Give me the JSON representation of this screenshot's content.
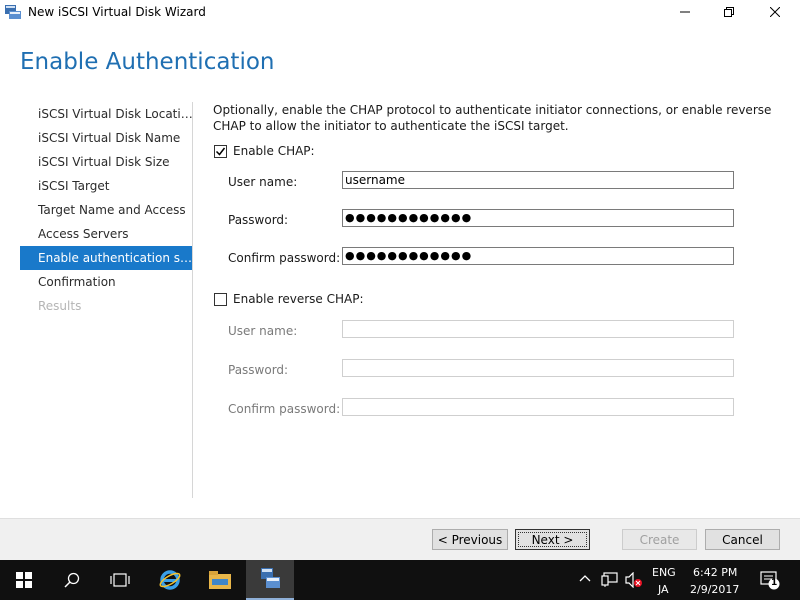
{
  "window": {
    "title": "New iSCSI Virtual Disk Wizard"
  },
  "header": {
    "title": "Enable Authentication"
  },
  "nav": {
    "items": [
      {
        "label": "iSCSI Virtual Disk Location",
        "state": "normal"
      },
      {
        "label": "iSCSI Virtual Disk Name",
        "state": "normal"
      },
      {
        "label": "iSCSI Virtual Disk Size",
        "state": "normal"
      },
      {
        "label": "iSCSI Target",
        "state": "normal"
      },
      {
        "label": "Target Name and Access",
        "state": "normal"
      },
      {
        "label": "Access Servers",
        "state": "normal"
      },
      {
        "label": "Enable authentication ser...",
        "state": "active"
      },
      {
        "label": "Confirmation",
        "state": "normal"
      },
      {
        "label": "Results",
        "state": "disabled"
      }
    ]
  },
  "content": {
    "description": "Optionally, enable the CHAP protocol to authenticate initiator connections, or enable reverse CHAP to allow the initiator to authenticate the iSCSI target.",
    "chap": {
      "label": "Enable CHAP:",
      "checked": true,
      "username_label": "User name:",
      "username_value": "username",
      "password_label": "Password:",
      "password_value": "●●●●●●●●●●●●",
      "confirm_label": "Confirm password:",
      "confirm_value": "●●●●●●●●●●●●"
    },
    "reverse_chap": {
      "label": "Enable reverse CHAP:",
      "checked": false,
      "username_label": "User name:",
      "username_value": "",
      "password_label": "Password:",
      "password_value": "",
      "confirm_label": "Confirm password:",
      "confirm_value": ""
    }
  },
  "buttons": {
    "previous": "< Previous",
    "next": "Next >",
    "create": "Create",
    "cancel": "Cancel"
  },
  "taskbar": {
    "lang_top": "ENG",
    "lang_bottom": "JA",
    "time": "6:42 PM",
    "date": "2/9/2017",
    "notification_count": "1"
  },
  "colors": {
    "accent": "#1979ca",
    "header": "#1f6fb2",
    "taskbar": "#101010"
  }
}
